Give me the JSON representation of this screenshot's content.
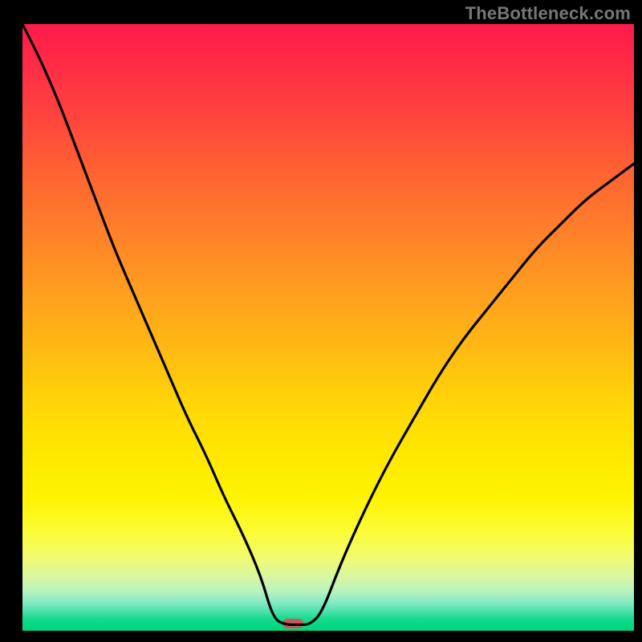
{
  "watermark": "TheBottleneck.com",
  "gradient_colors": {
    "top": "#ff1a4a",
    "mid1": "#ff7f2a",
    "mid2": "#ffe600",
    "bottom": "#00d67f"
  },
  "marker": {
    "x_frac": 0.442,
    "y_frac": 0.988,
    "color": "#c85a5a"
  },
  "chart_data": {
    "type": "line",
    "title": "",
    "xlabel": "",
    "ylabel": "",
    "xlim": [
      0,
      1
    ],
    "ylim": [
      0,
      1
    ],
    "note": "axes unlabeled in source; x and y are normalized 0..1 fractions of the plot area; y=0 at bottom (green), y=1 at top (red). The single black curve descends from top-left to a flat minimum near x≈0.41–0.47, then rises toward the right edge.",
    "series": [
      {
        "name": "bottleneck-curve",
        "color": "#000000",
        "x": [
          0.0,
          0.03,
          0.06,
          0.09,
          0.12,
          0.15,
          0.18,
          0.21,
          0.24,
          0.27,
          0.3,
          0.33,
          0.36,
          0.39,
          0.41,
          0.43,
          0.45,
          0.47,
          0.49,
          0.52,
          0.56,
          0.6,
          0.64,
          0.68,
          0.72,
          0.76,
          0.8,
          0.84,
          0.88,
          0.92,
          0.96,
          1.0
        ],
        "y": [
          1.0,
          0.94,
          0.87,
          0.79,
          0.71,
          0.63,
          0.56,
          0.49,
          0.42,
          0.35,
          0.29,
          0.22,
          0.16,
          0.09,
          0.02,
          0.01,
          0.01,
          0.01,
          0.03,
          0.11,
          0.2,
          0.28,
          0.35,
          0.42,
          0.48,
          0.53,
          0.58,
          0.63,
          0.67,
          0.71,
          0.74,
          0.77
        ]
      }
    ],
    "marker_point": {
      "x": 0.442,
      "y": 0.012
    }
  }
}
